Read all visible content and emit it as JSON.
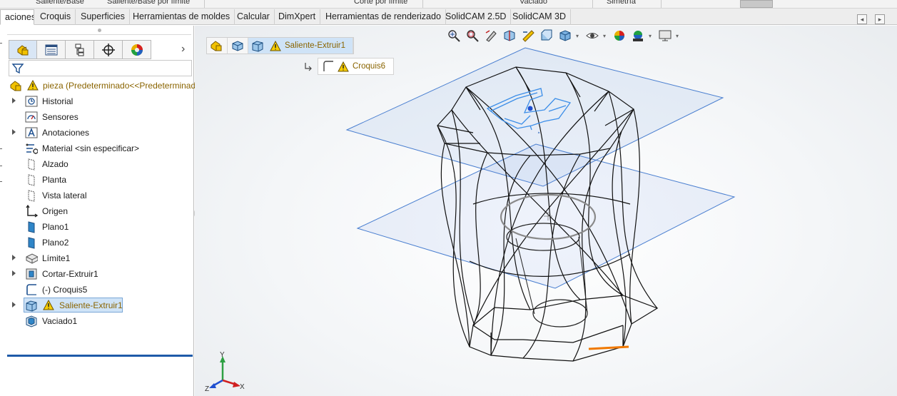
{
  "ribbon_top": {
    "frag1": "Saliente/Base",
    "frag2": "Saliente/Base por límite",
    "frag3": "Corte por límite",
    "frag4": "Vaciado",
    "frag5": "Simetría"
  },
  "tabs": [
    {
      "label": "aciones",
      "active": true
    },
    {
      "label": "Croquis"
    },
    {
      "label": "Superficies"
    },
    {
      "label": "Herramientas de moldes"
    },
    {
      "label": "Calcular"
    },
    {
      "label": "DimXpert"
    },
    {
      "label": "Herramientas de renderizado"
    },
    {
      "label": "SolidCAM 2.5D"
    },
    {
      "label": "SolidCAM 3D"
    }
  ],
  "tab_controls": {
    "prev": "◂",
    "next": "▸"
  },
  "panel": {
    "more": "›",
    "tree": {
      "root": "pieza  (Predeterminado<<Predeterminado>",
      "items": [
        {
          "label": "Historial",
          "icon": "history-icon",
          "expandable": true
        },
        {
          "label": "Sensores",
          "icon": "sensors-icon",
          "expandable": false
        },
        {
          "label": "Anotaciones",
          "icon": "annotations-icon",
          "expandable": true
        },
        {
          "label": "Material <sin especificar>",
          "icon": "material-icon",
          "expandable": false
        },
        {
          "label": "Alzado",
          "icon": "plane-icon",
          "expandable": false
        },
        {
          "label": "Planta",
          "icon": "plane-icon",
          "expandable": false
        },
        {
          "label": "Vista lateral",
          "icon": "plane-icon",
          "expandable": false
        },
        {
          "label": "Origen",
          "icon": "origin-icon",
          "expandable": false
        },
        {
          "label": "Plano1",
          "icon": "plane-blue-icon",
          "expandable": false
        },
        {
          "label": "Plano2",
          "icon": "plane-blue-icon",
          "expandable": false
        },
        {
          "label": "Límite1",
          "icon": "boundary-icon",
          "expandable": true
        },
        {
          "label": "Cortar-Extruir1",
          "icon": "cut-extrude-icon",
          "expandable": true
        },
        {
          "label": "(-) Croquis5",
          "icon": "sketch-icon",
          "expandable": false
        },
        {
          "label": "Saliente-Extruir1",
          "icon": "boss-extrude-icon",
          "expandable": true,
          "selected": true,
          "warning": true
        },
        {
          "label": "Vaciado1",
          "icon": "shell-icon",
          "expandable": false
        }
      ]
    }
  },
  "breadcrumb": {
    "feature": "Saliente-Extruir1",
    "sketch": "Croquis6"
  },
  "triad": {
    "y": "Y",
    "z": "Z",
    "x": "X"
  },
  "colors": {
    "accent_blue": "#4a7fd0",
    "warning_yellow": "#f2c200",
    "feature_text": "#8a6400",
    "selection": "#cfe3f7",
    "edge_orange": "#f07800",
    "sketch_blue": "#3c8ee8"
  }
}
